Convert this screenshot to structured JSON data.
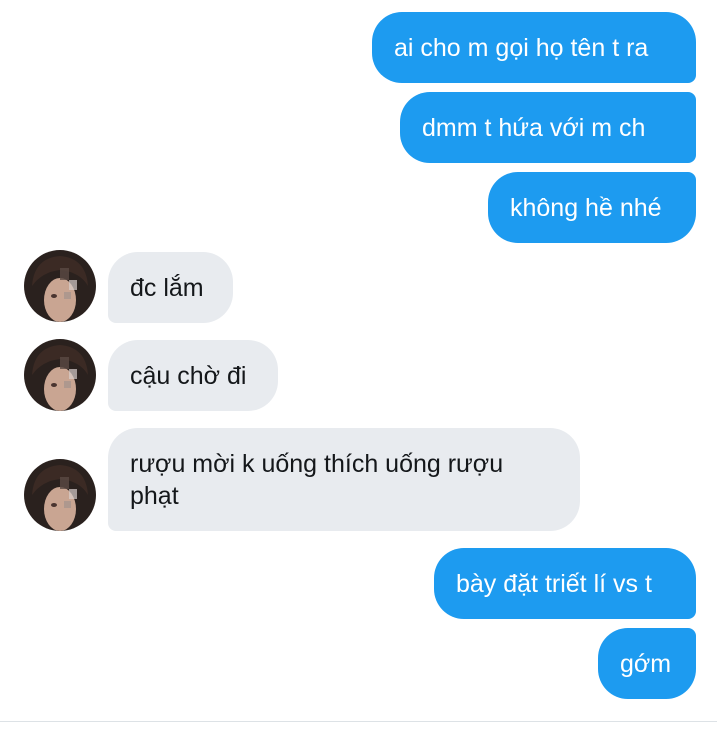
{
  "conversation": {
    "messages": [
      {
        "direction": "outgoing",
        "text": "ai cho m gọi họ tên t ra"
      },
      {
        "direction": "outgoing",
        "text": "dmm t hứa với m ch"
      },
      {
        "direction": "outgoing",
        "text": "không hề nhé"
      },
      {
        "direction": "incoming",
        "text": "đc lắm"
      },
      {
        "direction": "incoming",
        "text": "cậu chờ đi"
      },
      {
        "direction": "incoming",
        "text": "rượu mời k uống thích uống rượu phạt"
      },
      {
        "direction": "outgoing",
        "text": "bày đặt triết lí vs t"
      },
      {
        "direction": "outgoing",
        "text": "gớm"
      }
    ]
  },
  "colors": {
    "outgoing_bubble": "#1d9bf0",
    "incoming_bubble": "#e8ebef",
    "outgoing_text": "#ffffff",
    "incoming_text": "#14171a"
  },
  "icons": {
    "avatar": "contact-avatar-photo"
  }
}
